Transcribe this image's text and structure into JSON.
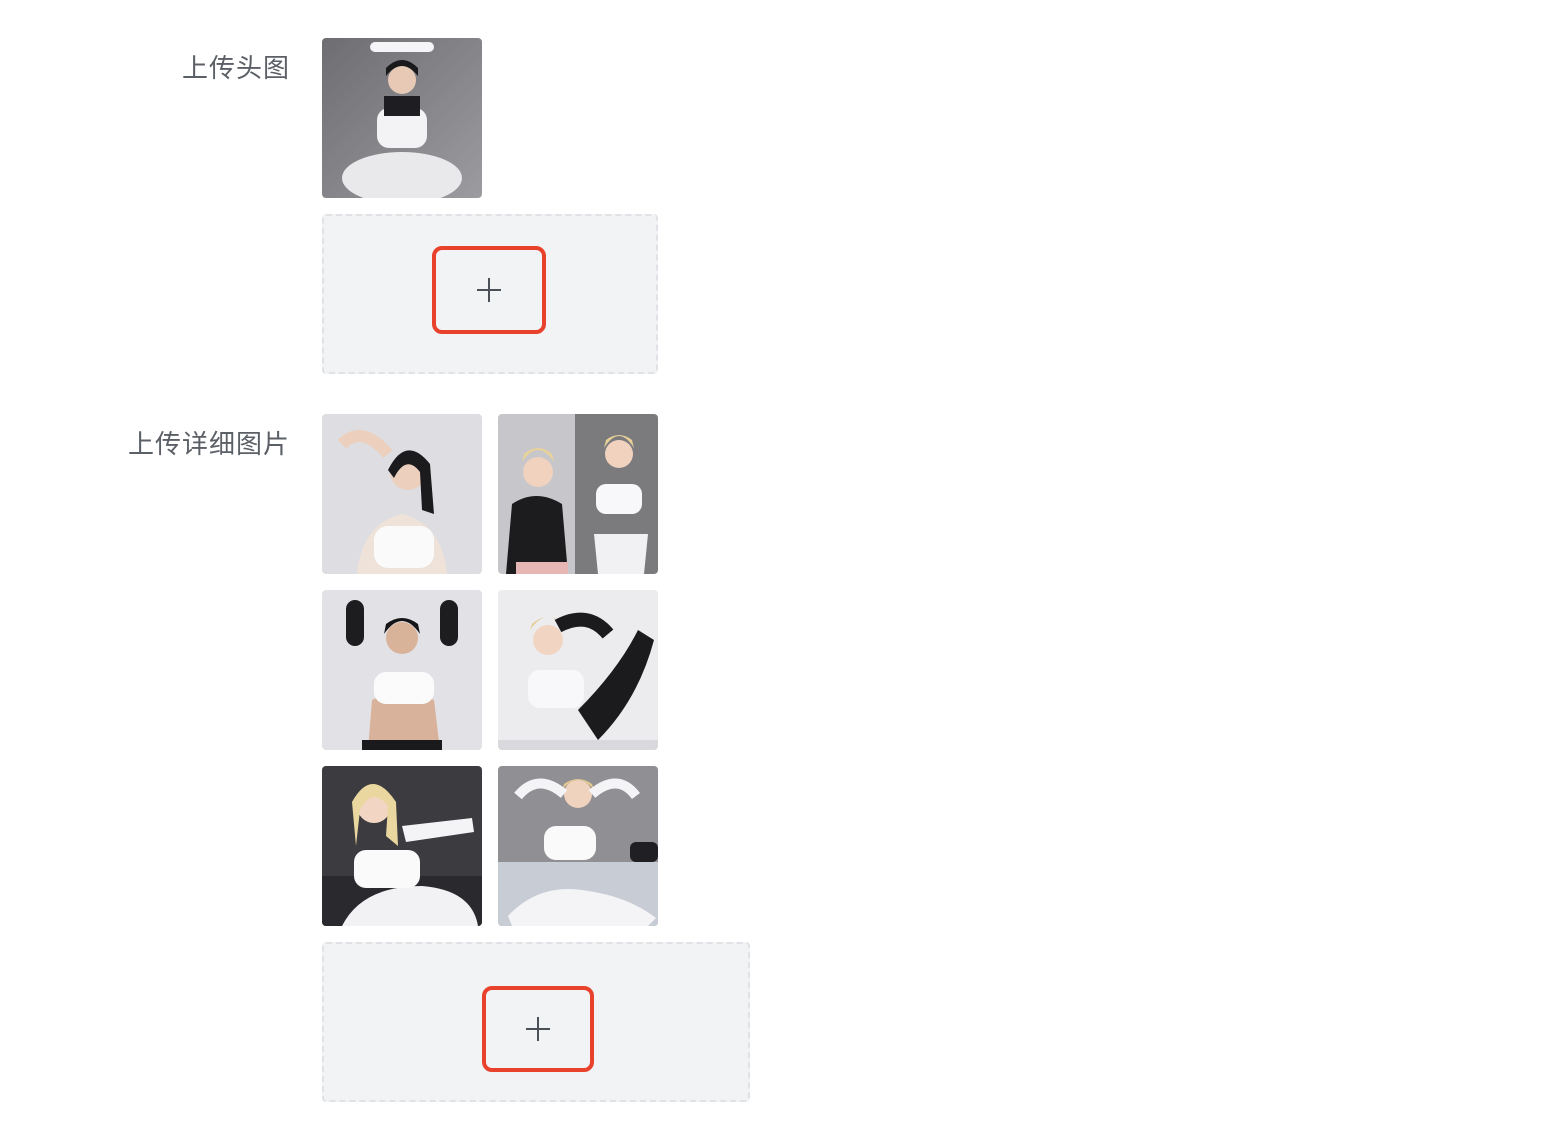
{
  "form": {
    "cover_label": "上传头图",
    "detail_label": "上传详细图片"
  },
  "cover_images": [
    {
      "alt": "cover-photo-1"
    }
  ],
  "detail_images": [
    {
      "alt": "detail-photo-1"
    },
    {
      "alt": "detail-photo-2"
    },
    {
      "alt": "detail-photo-3"
    },
    {
      "alt": "detail-photo-4"
    },
    {
      "alt": "detail-photo-5"
    },
    {
      "alt": "detail-photo-6"
    }
  ],
  "icons": {
    "add": "plus-icon"
  },
  "colors": {
    "highlight": "#e8412c",
    "upload_bg": "#f2f3f5",
    "label_text": "#5b5f66"
  }
}
